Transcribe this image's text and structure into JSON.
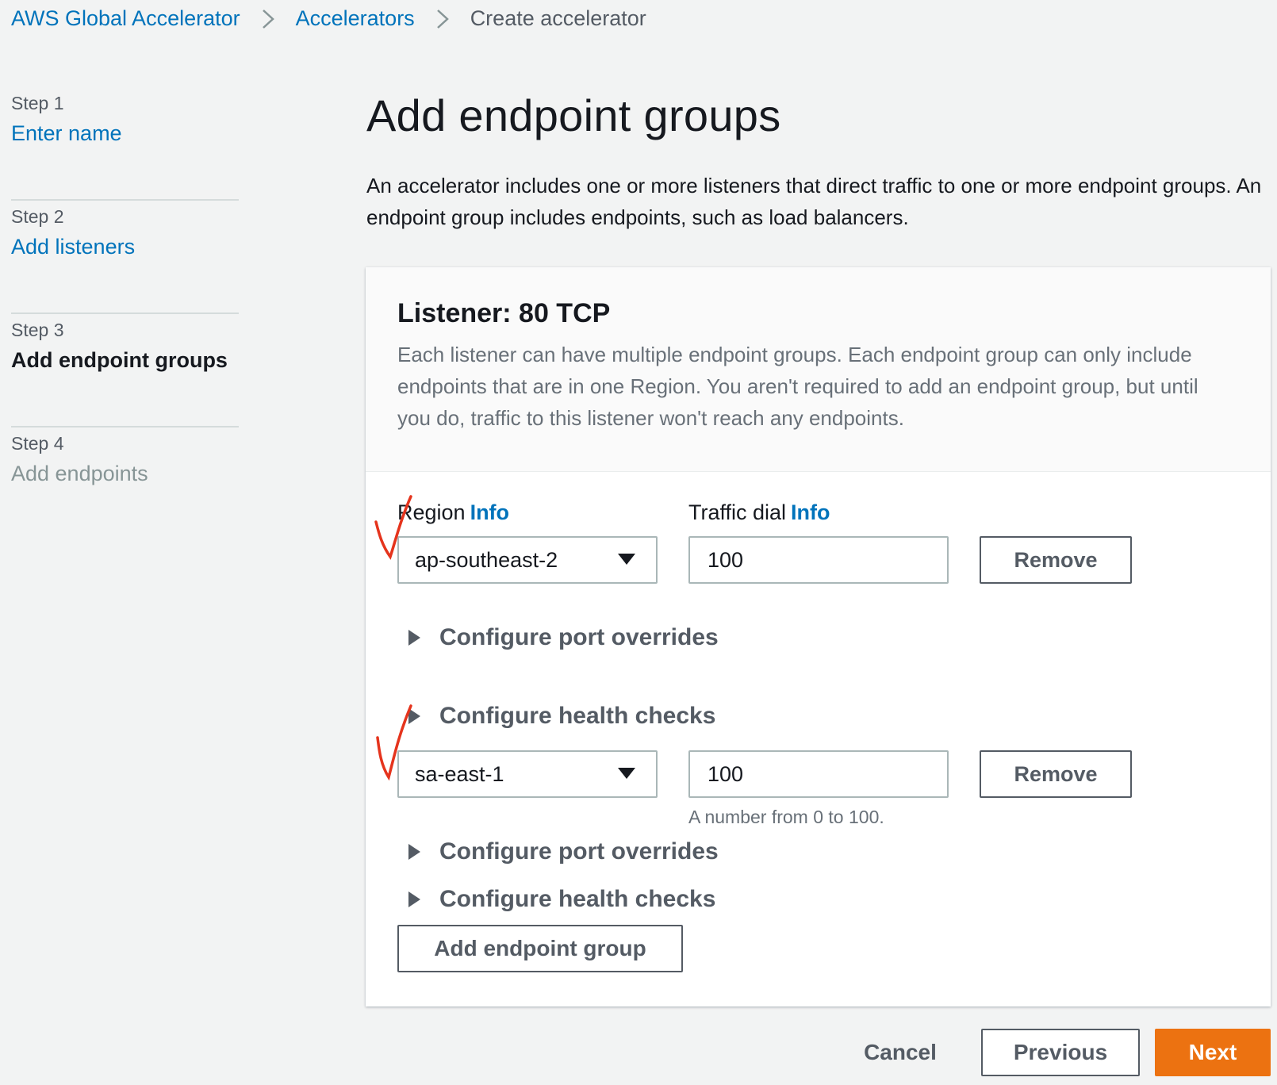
{
  "breadcrumb": {
    "items": [
      {
        "label": "AWS Global Accelerator"
      },
      {
        "label": "Accelerators"
      },
      {
        "label": "Create accelerator"
      }
    ]
  },
  "steps": [
    {
      "num": "Step 1",
      "label": "Enter name",
      "state": "link"
    },
    {
      "num": "Step 2",
      "label": "Add listeners",
      "state": "link"
    },
    {
      "num": "Step 3",
      "label": "Add endpoint groups",
      "state": "active"
    },
    {
      "num": "Step 4",
      "label": "Add endpoints",
      "state": "disabled"
    }
  ],
  "main": {
    "title": "Add endpoint groups",
    "description": "An accelerator includes one or more listeners that direct traffic to one or more endpoint groups. An endpoint group includes endpoints, such as load balancers."
  },
  "panel": {
    "title": "Listener: 80 TCP",
    "description": "Each listener can have multiple endpoint groups. Each endpoint group can only include endpoints that are in one Region. You aren't required to add an endpoint group, but until you do, traffic to this listener won't reach any endpoints.",
    "region_label": "Region",
    "traffic_label": "Traffic dial",
    "info_label": "Info",
    "groups": [
      {
        "region": "ap-southeast-2",
        "traffic": "100",
        "remove_label": "Remove",
        "port_overrides": "Configure port overrides",
        "health_checks": "Configure health checks"
      },
      {
        "region": "sa-east-1",
        "traffic": "100",
        "remove_label": "Remove",
        "hint": "A number from 0 to 100.",
        "port_overrides": "Configure port overrides",
        "health_checks": "Configure health checks"
      }
    ],
    "add_group_label": "Add endpoint group"
  },
  "footer": {
    "cancel_label": "Cancel",
    "previous_label": "Previous",
    "next_label": "Next"
  },
  "colors": {
    "link": "#0073bb",
    "primary_button": "#ec7211",
    "annotation": "#e5341d"
  },
  "icons": [
    "chevron-right-icon",
    "caret-down-icon",
    "caret-right-icon",
    "handwritten-check-icon"
  ]
}
